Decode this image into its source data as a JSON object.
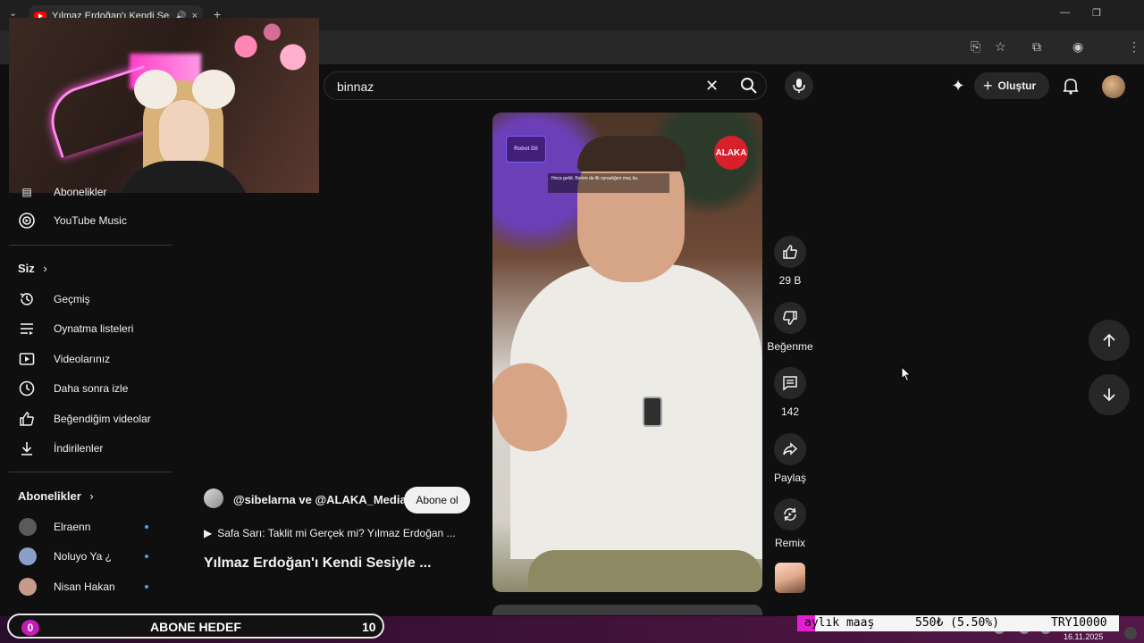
{
  "browser": {
    "tab_title": "Yılmaz Erdoğan'ı Kendi Sesi",
    "tab_close": "×",
    "new_tab": "+"
  },
  "masthead": {
    "search_value": "binnaz",
    "create_label": "Oluştur"
  },
  "sidebar": {
    "top_items": [
      {
        "label": "Abonelikler",
        "icon": "subscriptions-icon"
      },
      {
        "label": "YouTube Music",
        "icon": "youtube-music-icon"
      }
    ],
    "you_section_title": "Siz",
    "you_items": [
      {
        "label": "Geçmiş",
        "icon": "history-icon"
      },
      {
        "label": "Oynatma listeleri",
        "icon": "playlists-icon"
      },
      {
        "label": "Videolarınız",
        "icon": "your-videos-icon"
      },
      {
        "label": "Daha sonra izle",
        "icon": "watch-later-icon"
      },
      {
        "label": "Beğendiğim videolar",
        "icon": "liked-videos-icon"
      },
      {
        "label": "İndirilenler",
        "icon": "downloads-icon"
      }
    ],
    "subs_section_title": "Abonelikler",
    "subscriptions": [
      {
        "name": "Elraenn",
        "color": "#5a5a5a"
      },
      {
        "name": "Noluyo Ya ¿",
        "color": "#8aa0c8"
      },
      {
        "name": "Nisan Hakan",
        "color": "#c79b8a"
      }
    ]
  },
  "video": {
    "logo_left": "Robot Dil",
    "logo_right": "ALAKA",
    "caption": "Hoca geldi. Benim de ilk oynadığım maç bu."
  },
  "actions": {
    "like_count": "29 B",
    "dislike_label": "Beğenme",
    "comment_count": "142",
    "share_label": "Paylaş",
    "remix_label": "Remix"
  },
  "info": {
    "channels": "@sibelarna ve @ALAKA_Media",
    "subscribe_label": "Abone ol",
    "sound_line": "Safa Sarı: Taklit mi Gerçek mi? Yılmaz Erdoğan ...",
    "title": "Yılmaz Erdoğan'ı Kendi Sesiyle ..."
  },
  "overlay": {
    "goal_current": "0",
    "goal_label": "ABONE HEDEF",
    "goal_target": "10",
    "salary_label": "aylık maaş",
    "salary_value": "550₺ (5.50%)",
    "salary_target": "TRY10000",
    "salary_progress": 0.055,
    "date": "16.11.2025"
  },
  "colors": {
    "background": "#0f0f0f",
    "accent_blue": "#3ea6ff",
    "overlay_magenta": "#e41fd1"
  }
}
